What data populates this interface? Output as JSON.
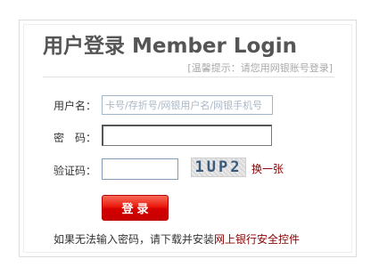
{
  "header": {
    "title": "用户登录 Member Login",
    "hint": "[温馨提示：请您用网银账号登录]"
  },
  "form": {
    "username_label": "用户名：",
    "username_placeholder": "卡号/存折号/网银用户名/网银手机号",
    "password_label": "密　码：",
    "password_value": "",
    "captcha_label": "验证码：",
    "captcha_value": "",
    "captcha_code": "1UP2",
    "refresh_label": "换一张",
    "login_button": "登录"
  },
  "footer": {
    "text": "如果无法输入密码，请下载并安装",
    "link": "网上银行安全控件"
  },
  "colors": {
    "accent": "#e00000",
    "link": "#8b0000",
    "title": "#555555"
  }
}
